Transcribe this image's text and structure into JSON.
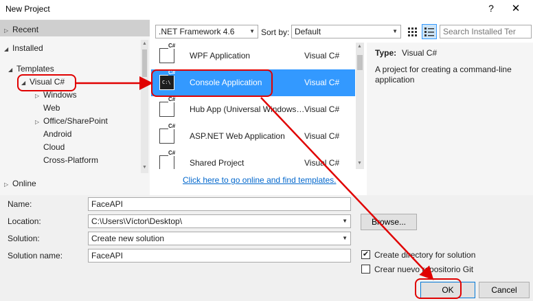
{
  "window": {
    "title": "New Project",
    "help_glyph": "?",
    "close_glyph": "✕"
  },
  "tree": {
    "recent": "Recent",
    "installed": "Installed",
    "templates": "Templates",
    "visual_cs": "Visual C#",
    "children": [
      "Windows",
      "Web",
      "Office/SharePoint",
      "Android",
      "Cloud",
      "Cross-Platform"
    ],
    "online": "Online"
  },
  "toolbar": {
    "framework": ".NET Framework 4.6",
    "sort_by_label": "Sort by:",
    "sort_by_value": "Default",
    "search_placeholder": "Search Installed Ter"
  },
  "templates": [
    {
      "name": "WPF Application",
      "lang": "Visual C#",
      "icon": "wpf-app-icon",
      "selected": false
    },
    {
      "name": "Console Application",
      "lang": "Visual C#",
      "icon": "console-app-icon",
      "selected": true
    },
    {
      "name": "Hub App (Universal Windows…",
      "lang": "Visual C#",
      "icon": "hub-app-icon",
      "selected": false
    },
    {
      "name": "ASP.NET Web Application",
      "lang": "Visual C#",
      "icon": "web-app-icon",
      "selected": false
    },
    {
      "name": "Shared Project",
      "lang": "Visual C#",
      "icon": "shared-project-icon",
      "selected": false
    }
  ],
  "online_link": "Click here to go online and find templates.",
  "description": {
    "type_label": "Type:",
    "type_value": "Visual C#",
    "text": "A project for creating a command-line application"
  },
  "form": {
    "name_label": "Name:",
    "name_value": "FaceAPI",
    "location_label": "Location:",
    "location_value": "C:\\Users\\Víctor\\Desktop\\",
    "browse_label": "Browse...",
    "solution_label": "Solution:",
    "solution_value": "Create new solution",
    "solution_name_label": "Solution name:",
    "solution_name_value": "FaceAPI",
    "create_dir_label": "Create directory for solution",
    "create_dir_checked": true,
    "git_label": "Crear nuevo repositorio Git",
    "git_checked": false,
    "ok_label": "OK",
    "cancel_label": "Cancel"
  },
  "colors": {
    "selection": "#3399ff",
    "annotation": "#e00000",
    "link": "#0066cc"
  }
}
